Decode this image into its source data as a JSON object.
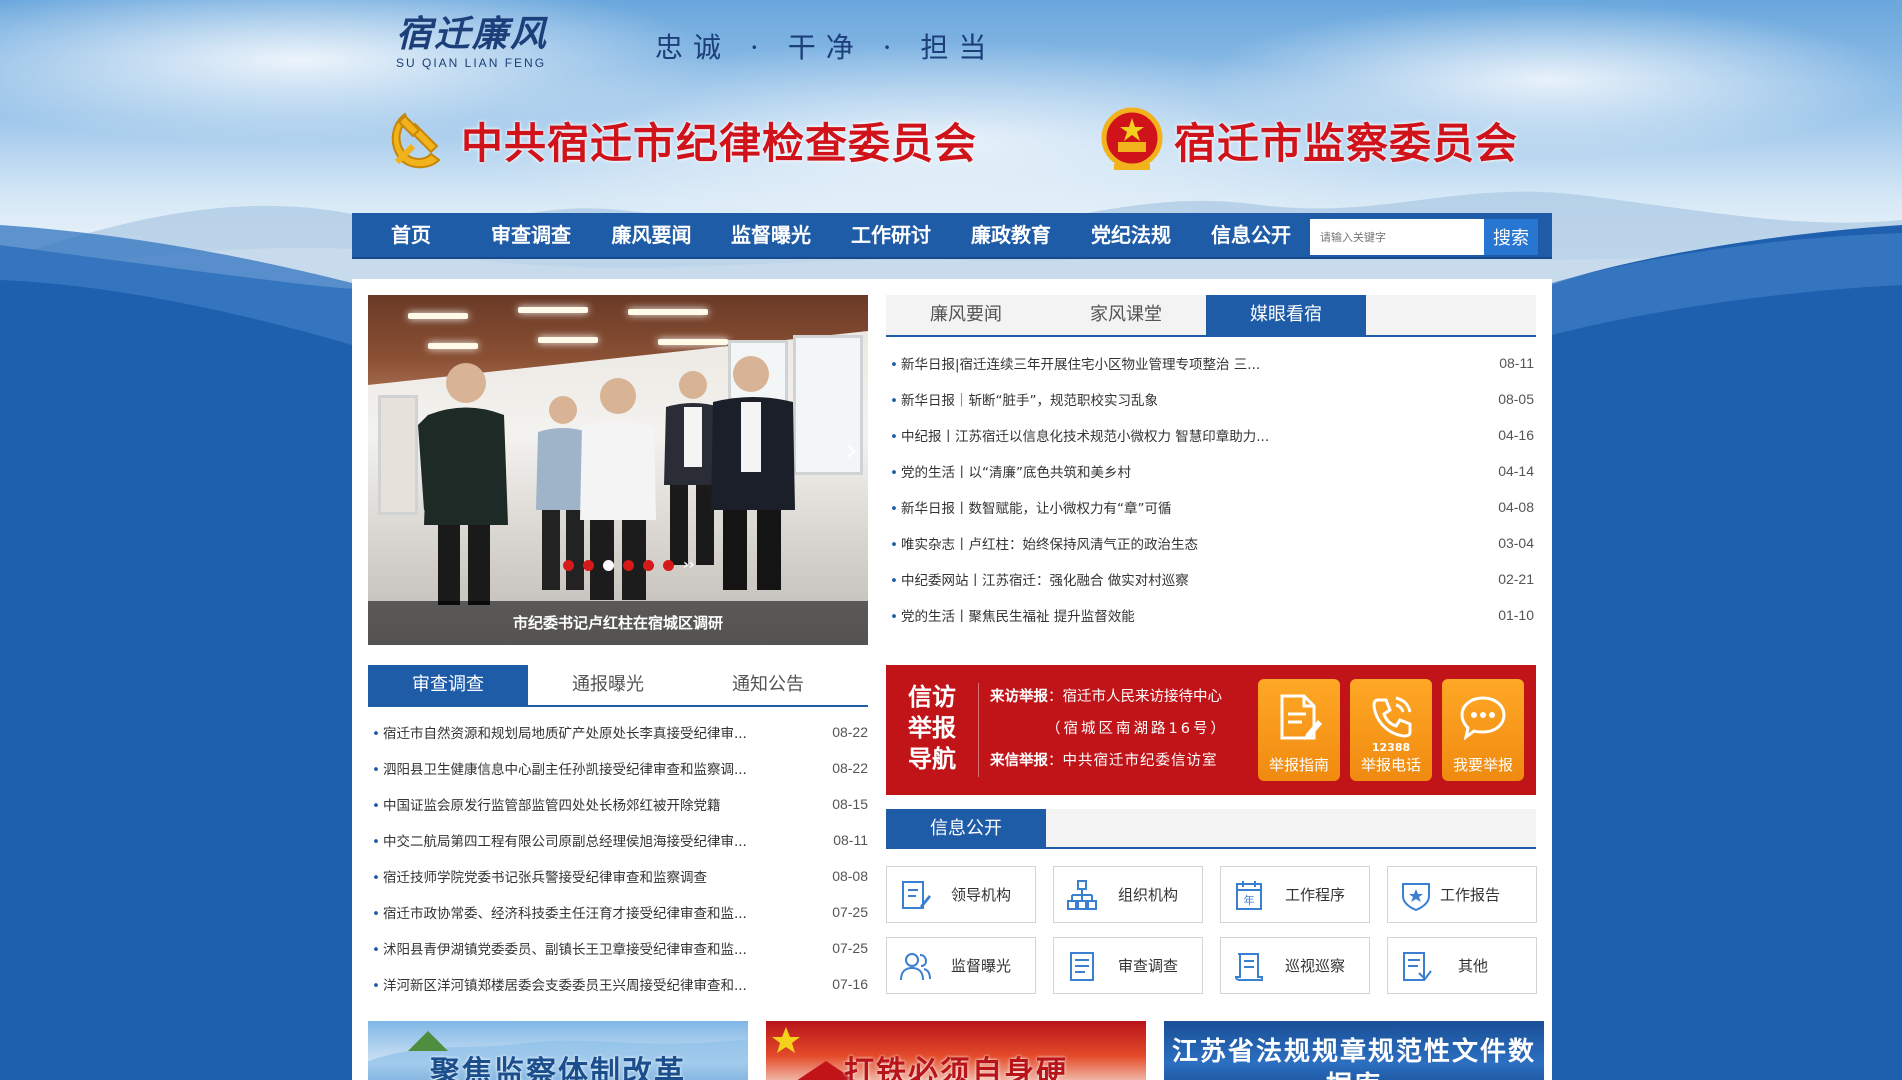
{
  "header": {
    "logo_cn": "宿迁廉风",
    "logo_en": "SU QIAN LIAN FENG",
    "slogan": "忠诚 · 干净 · 担当",
    "org_left": "中共宿迁市纪律检查委员会",
    "org_right": "宿迁市监察委员会"
  },
  "nav": {
    "items": [
      "首页",
      "审查调查",
      "廉风要闻",
      "监督曝光",
      "工作研讨",
      "廉政教育",
      "党纪法规",
      "信息公开"
    ],
    "search_placeholder": "请输入关键字",
    "search_button": "搜索"
  },
  "carousel": {
    "caption": "市纪委书记卢红柱在宿城区调研",
    "dot_count": 6,
    "active_dot": 3,
    "next_label": "››"
  },
  "media_panel": {
    "tabs": [
      "廉风要闻",
      "家风课堂",
      "媒眼看宿"
    ],
    "active_tab": 2,
    "items": [
      {
        "title": "新华日报|宿迁连续三年开展住宅小区物业管理专项整治 三...",
        "date": "08-11"
      },
      {
        "title": "新华日报｜斩断“脏手”，规范职校实习乱象",
        "date": "08-05"
      },
      {
        "title": "中纪报丨江苏宿迁以信息化技术规范小微权力 智慧印章助力...",
        "date": "04-16"
      },
      {
        "title": "党的生活丨以“清廉”底色共筑和美乡村",
        "date": "04-14"
      },
      {
        "title": "新华日报丨数智赋能，让小微权力有“章”可循",
        "date": "04-08"
      },
      {
        "title": "唯实杂志丨卢红柱：始终保持风清气正的政治生态",
        "date": "03-04"
      },
      {
        "title": "中纪委网站丨江苏宿迁：强化融合 做实对村巡察",
        "date": "02-21"
      },
      {
        "title": "党的生活丨聚焦民生福祉 提升监督效能",
        "date": "01-10"
      }
    ]
  },
  "investigation_panel": {
    "tabs": [
      "审查调查",
      "通报曝光",
      "通知公告"
    ],
    "active_tab": 0,
    "items": [
      {
        "title": "宿迁市自然资源和规划局地质矿产处原处长李真接受纪律审...",
        "date": "08-22"
      },
      {
        "title": "泗阳县卫生健康信息中心副主任孙凯接受纪律审查和监察调...",
        "date": "08-22"
      },
      {
        "title": "中国证监会原发行监管部监管四处处长杨郊红被开除党籍",
        "date": "08-15"
      },
      {
        "title": "中交二航局第四工程有限公司原副总经理侯旭海接受纪律审...",
        "date": "08-11"
      },
      {
        "title": "宿迁技师学院党委书记张兵警接受纪律审查和监察调查",
        "date": "08-08"
      },
      {
        "title": "宿迁市政协常委、经济科技委主任汪育才接受纪律审查和监...",
        "date": "07-25"
      },
      {
        "title": "沭阳县青伊湖镇党委委员、副镇长王卫章接受纪律审查和监...",
        "date": "07-25"
      },
      {
        "title": "洋河新区洋河镇郑楼居委会支委委员王兴周接受纪律审查和...",
        "date": "07-16"
      }
    ]
  },
  "petition": {
    "title": "信访举报导航",
    "visit_label": "来访举报",
    "visit_text": "宿迁市人民来访接待中心",
    "address": "（宿城区南湖路16号）",
    "letter_label": "来信举报",
    "letter_text": "中共宿迁市纪委信访室",
    "buttons": [
      {
        "label": "举报指南",
        "icon": "document-icon",
        "sub": ""
      },
      {
        "label": "举报电话",
        "icon": "phone-icon",
        "sub": "12388"
      },
      {
        "label": "我要举报",
        "icon": "chat-icon",
        "sub": ""
      }
    ],
    "colors": {
      "panel": "#c01419",
      "button": "#f59512"
    }
  },
  "info_public": {
    "tab": "信息公开",
    "cells": [
      {
        "label": "领导机构",
        "icon": "leadership-icon"
      },
      {
        "label": "组织机构",
        "icon": "org-chart-icon"
      },
      {
        "label": "工作程序",
        "icon": "calendar-icon"
      },
      {
        "label": "工作报告",
        "icon": "badge-icon"
      },
      {
        "label": "监督曝光",
        "icon": "people-icon"
      },
      {
        "label": "审查调查",
        "icon": "list-doc-icon"
      },
      {
        "label": "巡视巡察",
        "icon": "scroll-icon"
      },
      {
        "label": "其他",
        "icon": "other-doc-icon"
      }
    ]
  },
  "banners": [
    {
      "text": "聚焦监察体制改革"
    },
    {
      "text": "打铁必须自身硬"
    },
    {
      "text": "江苏省法规规章规范性文件数据库"
    }
  ],
  "colors": {
    "nav": "#1f5ca8",
    "accent_red": "#d0121b"
  }
}
